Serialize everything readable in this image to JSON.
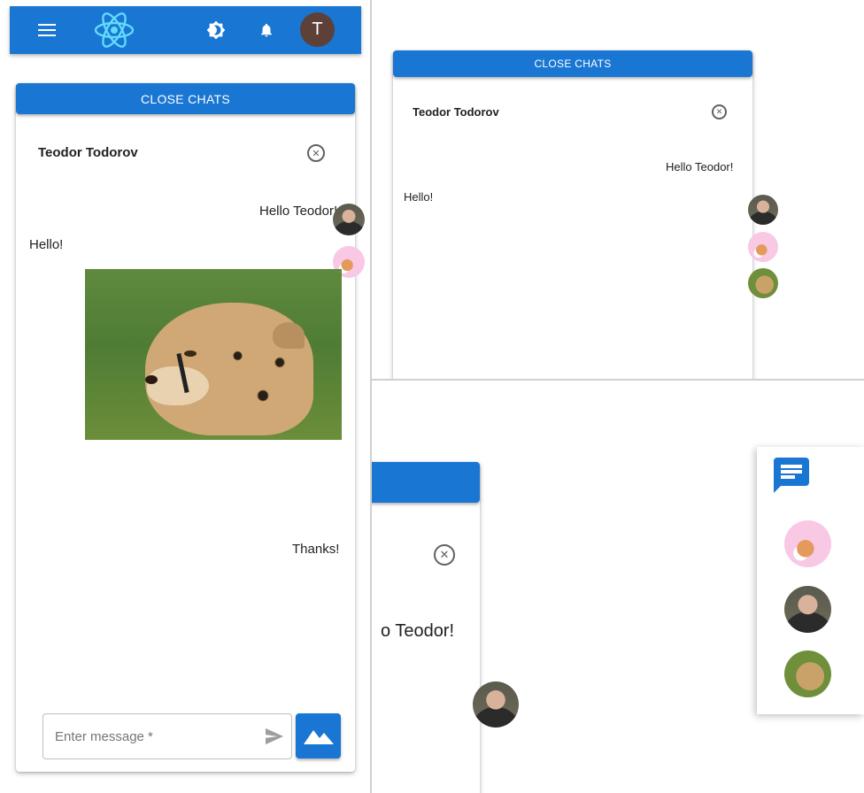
{
  "app": {
    "menu_icon": "menu-icon",
    "logo_icon": "react-logo-icon",
    "theme_icon": "brightness-icon",
    "bell_icon": "notifications-icon",
    "avatar_initial": "T",
    "accent_color": "#1976d2"
  },
  "chat": {
    "close_chats_label": "CLOSE CHATS",
    "contact_name": "Teodor Todorov",
    "messages": [
      {
        "from": "me",
        "text": "Hello Teodor!"
      },
      {
        "from": "them",
        "text": "Hello!"
      },
      {
        "from": "me",
        "text": "Thanks!"
      }
    ],
    "input_placeholder": "Enter message *",
    "send_icon": "send-icon",
    "image_icon": "image-icon"
  },
  "panel2": {
    "close_chats_label": "CLOSE CHATS",
    "contact_name": "Teodor Todorov",
    "msg_out": "Hello Teodor!",
    "msg_in": "Hello!"
  },
  "panel3": {
    "partial_msg": "o Teodor!",
    "chat_icon": "chat-bubble-icon"
  }
}
